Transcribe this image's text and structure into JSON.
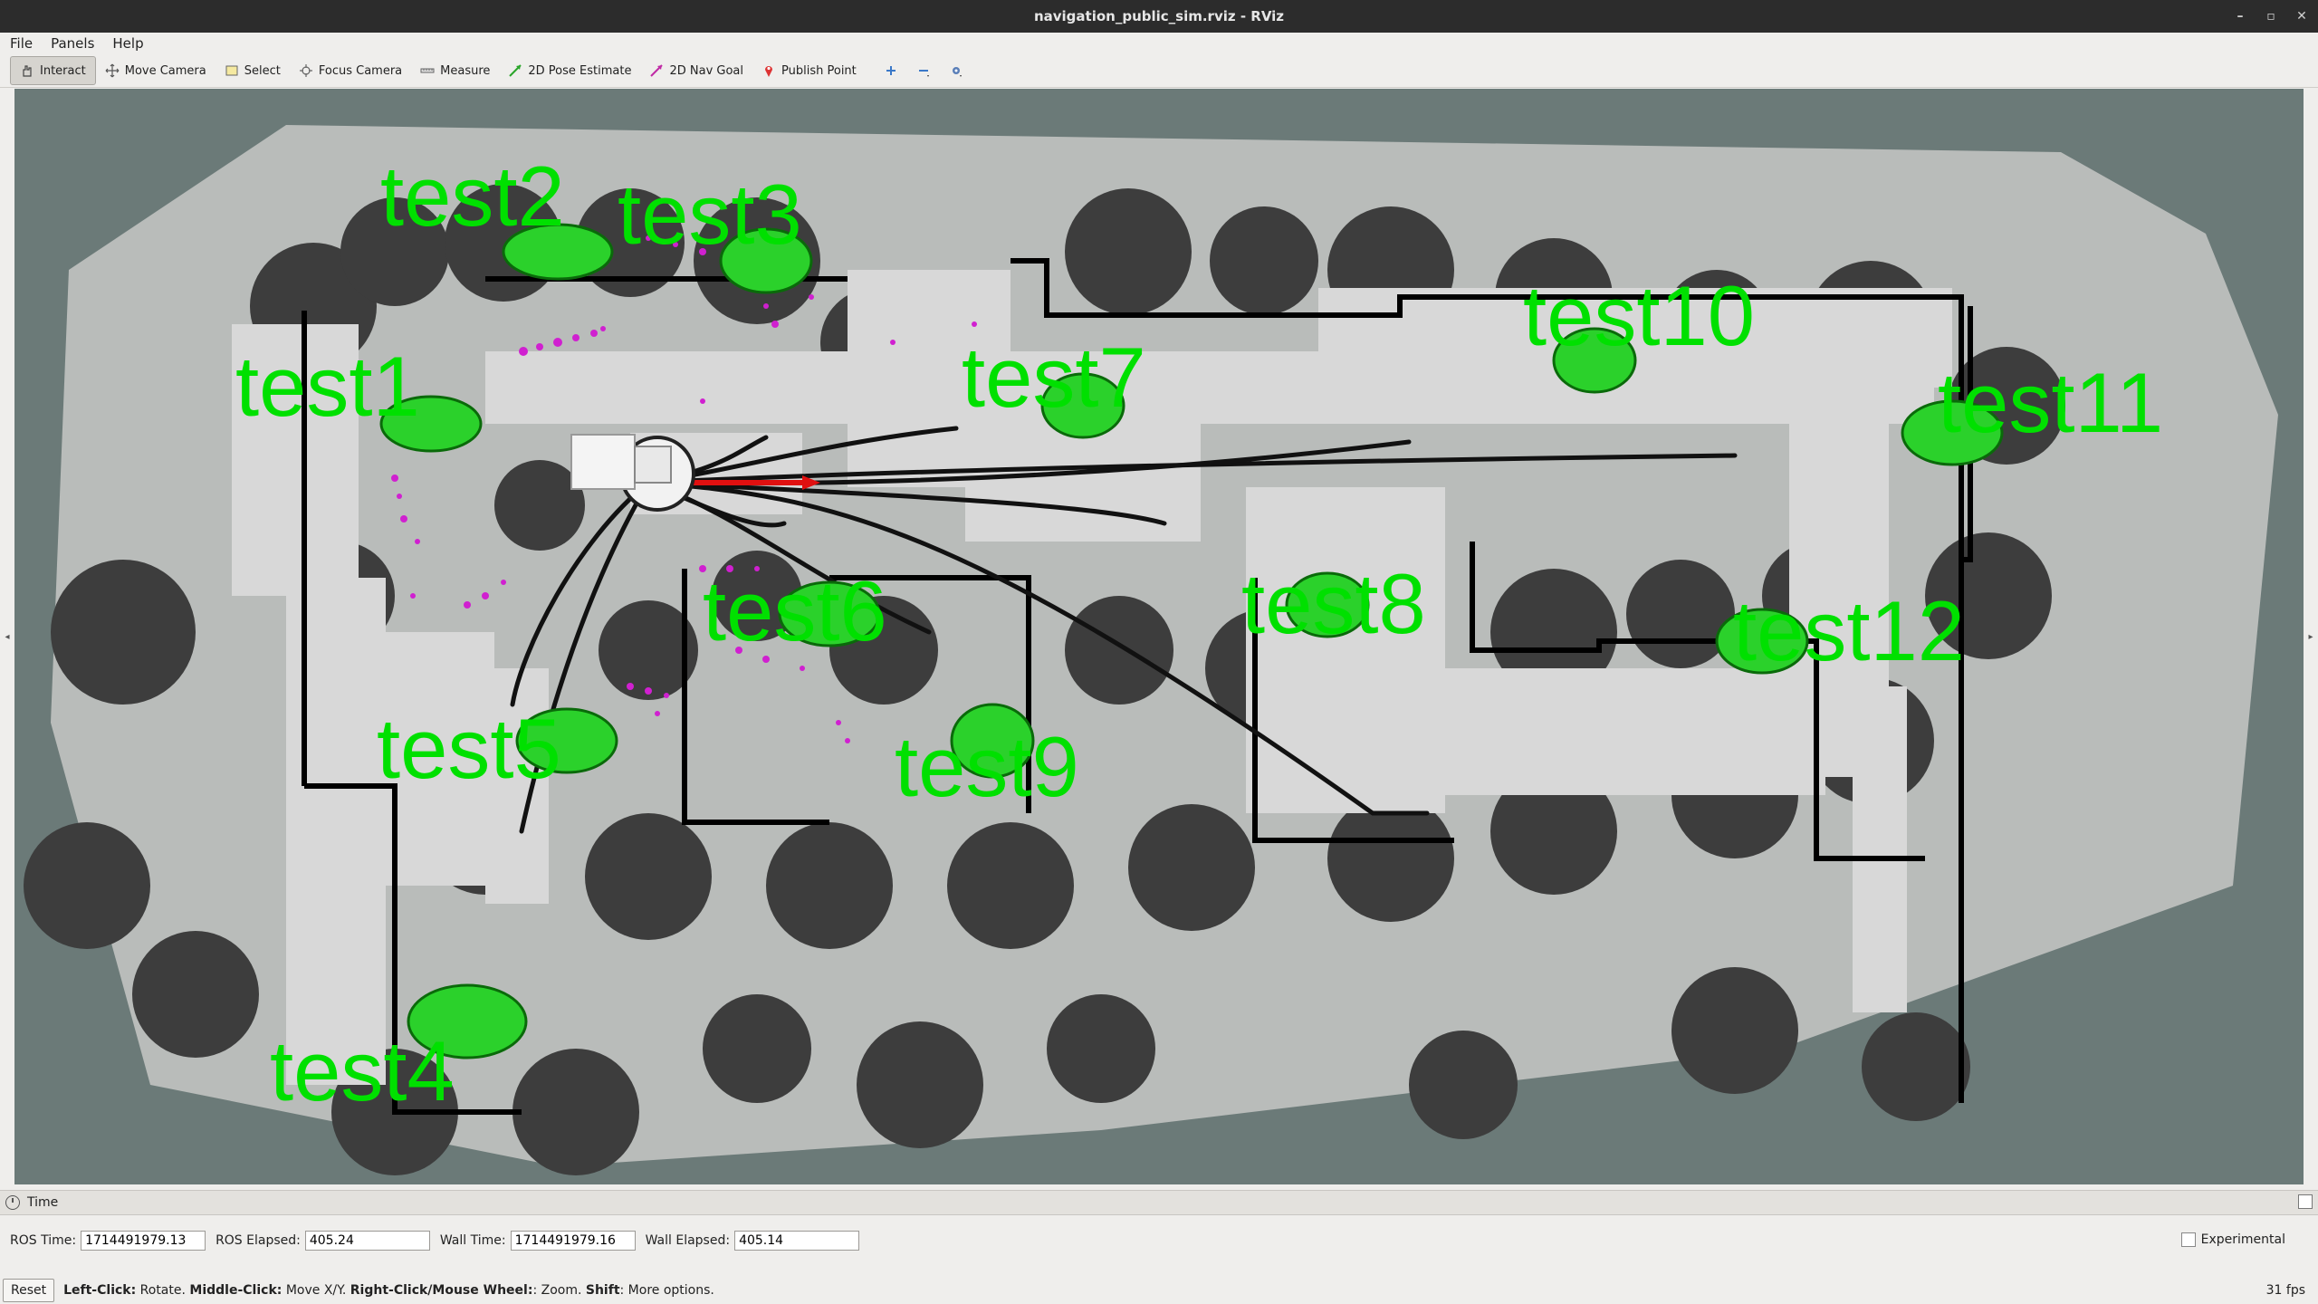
{
  "window": {
    "title": "navigation_public_sim.rviz - RViz"
  },
  "menu": [
    "File",
    "Panels",
    "Help"
  ],
  "toolbar": {
    "tools": [
      {
        "label": "Interact",
        "icon": "interact-icon",
        "active": true
      },
      {
        "label": "Move Camera",
        "icon": "move-camera-icon"
      },
      {
        "label": "Select",
        "icon": "select-icon"
      },
      {
        "label": "Focus Camera",
        "icon": "focus-camera-icon"
      },
      {
        "label": "Measure",
        "icon": "measure-icon"
      },
      {
        "label": "2D Pose Estimate",
        "icon": "pose-estimate-icon"
      },
      {
        "label": "2D Nav Goal",
        "icon": "nav-goal-icon"
      },
      {
        "label": "Publish Point",
        "icon": "publish-point-icon"
      }
    ],
    "extra_icons": [
      "add-tool-icon",
      "remove-tool-icon",
      "tool-properties-icon"
    ]
  },
  "viewport": {
    "labels": [
      "test1",
      "test2",
      "test3",
      "test4",
      "test5",
      "test6",
      "test7",
      "test8",
      "test9",
      "test10",
      "test11",
      "test12"
    ],
    "colors": {
      "label": "#00e000",
      "free_space": "#d9d9d9",
      "unknown": "#6b7a78",
      "costmap": "#3a3a3a",
      "wall": "#000000",
      "laser_points": "#d020d0",
      "path": "#111111",
      "goal_arrow": "#e01010"
    }
  },
  "time_panel": {
    "title": "Time",
    "ros_time_label": "ROS Time:",
    "ros_time": "1714491979.13",
    "ros_elapsed_label": "ROS Elapsed:",
    "ros_elapsed": "405.24",
    "wall_time_label": "Wall Time:",
    "wall_time": "1714491979.16",
    "wall_elapsed_label": "Wall Elapsed:",
    "wall_elapsed": "405.14",
    "experimental_label": "Experimental"
  },
  "status": {
    "reset_label": "Reset",
    "hint_left_key": "Left-Click:",
    "hint_left_val": "Rotate.",
    "hint_middle_key": "Middle-Click:",
    "hint_middle_val": "Move X/Y.",
    "hint_right_key": "Right-Click/Mouse Wheel:",
    "hint_right_val": ": Zoom.",
    "hint_shift_key": "Shift",
    "hint_shift_val": ": More options.",
    "fps": "31 fps"
  }
}
